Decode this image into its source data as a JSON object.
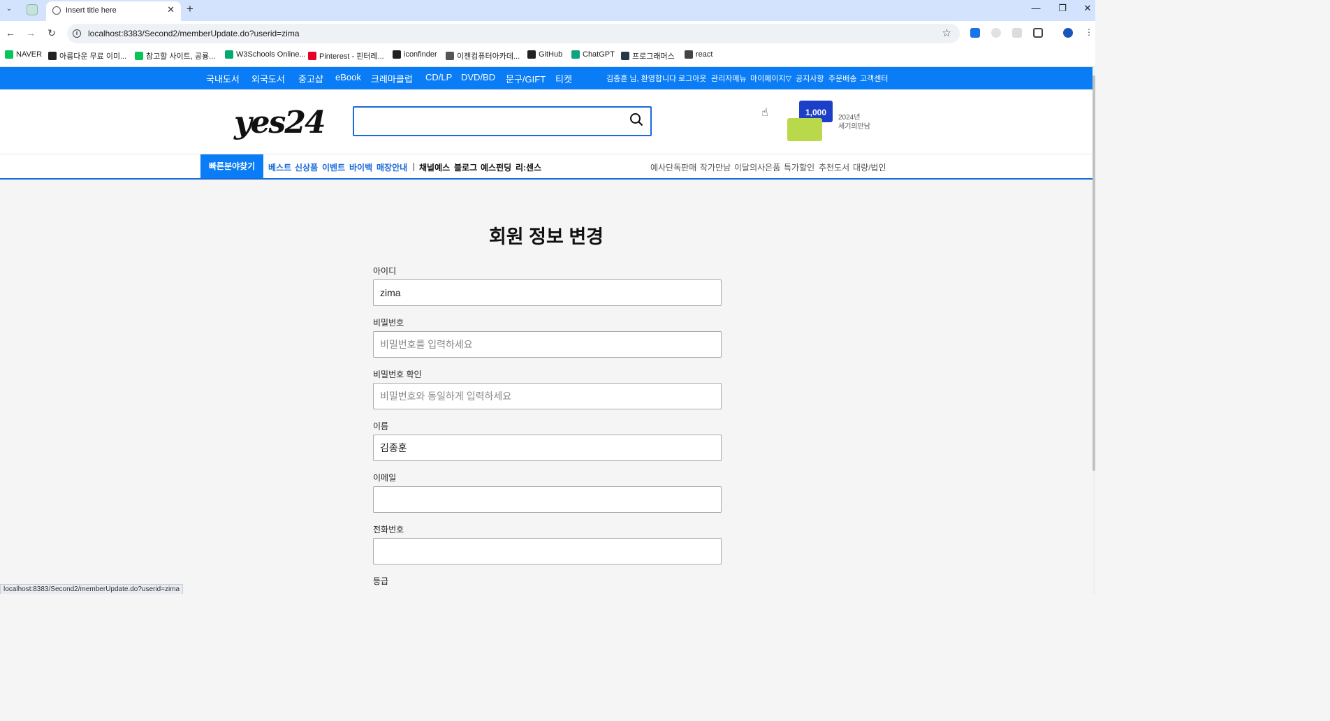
{
  "browser": {
    "tab_title": "Insert title here",
    "url": "localhost:8383/Second2/memberUpdate.do?userid=zima",
    "status_url": "localhost:8383/Second2/memberUpdate.do?userid=zima"
  },
  "bookmarks": [
    {
      "label": "NAVER",
      "icon": "naver-icon",
      "color": "#03c75a"
    },
    {
      "label": "아름다운 무료 이미...",
      "icon": "image-site-icon",
      "color": "#222222"
    },
    {
      "label": "참고할 사이트, 공룡...",
      "icon": "line-icon",
      "color": "#06c755"
    },
    {
      "label": "W3Schools Online...",
      "icon": "w3schools-icon",
      "color": "#04aa6d"
    },
    {
      "label": "Pinterest - 핀터레...",
      "icon": "pinterest-icon",
      "color": "#e60023"
    },
    {
      "label": "iconfinder",
      "icon": "iconfinder-icon",
      "color": "#222222"
    },
    {
      "label": "이젠컴퓨터아카데...",
      "icon": "globe-icon",
      "color": "#555555"
    },
    {
      "label": "GitHub",
      "icon": "github-icon",
      "color": "#222222"
    },
    {
      "label": "ChatGPT",
      "icon": "chatgpt-icon",
      "color": "#10a37f"
    },
    {
      "label": "프로그래머스",
      "icon": "programmers-icon",
      "color": "#263747"
    },
    {
      "label": "react",
      "icon": "folder-icon",
      "color": "#444444"
    }
  ],
  "topnav": {
    "categories": [
      "국내도서",
      "외국도서",
      "중고샵",
      "eBook",
      "크레마클럽",
      "CD/LP",
      "DVD/BD",
      "문구/GIFT",
      "티켓"
    ],
    "user_links": [
      "김종훈 님, 환영합니다",
      "로그아웃",
      "관리자메뉴",
      "마이페이지▽",
      "공지사항",
      "주문배송",
      "고객센터"
    ]
  },
  "header": {
    "logo_text": "yes24",
    "search_placeholder": "",
    "promo_card_value": "1,000",
    "promo_text_1": "2024년",
    "promo_text_2": "세기의만남"
  },
  "subnav": {
    "quick_button": "빠른분야찾기",
    "blue_links": [
      "베스트",
      "신상품",
      "이벤트",
      "바이백",
      "매장안내"
    ],
    "black_links": [
      "채널예스",
      "블로그",
      "예스펀딩",
      "리:센스"
    ],
    "gray_links": [
      "예사단독판매",
      "작가만남",
      "이달의사은품",
      "특가할인",
      "추천도서",
      "대량/법인"
    ]
  },
  "form": {
    "title": "회원 정보 변경",
    "fields": [
      {
        "label": "아이디",
        "value": "zima",
        "placeholder": ""
      },
      {
        "label": "비밀번호",
        "value": "",
        "placeholder": "비밀번호를 입력하세요"
      },
      {
        "label": "비밀번호 확인",
        "value": "",
        "placeholder": "비밀번호와 동일하게 입력하세요"
      },
      {
        "label": "이름",
        "value": "김종훈",
        "placeholder": ""
      },
      {
        "label": "이메일",
        "value": "",
        "placeholder": ""
      },
      {
        "label": "전화번호",
        "value": "",
        "placeholder": ""
      }
    ],
    "grade_label": "등급"
  },
  "colors": {
    "brand_blue": "#0a7cf5",
    "accent_blue": "#1a6ad9",
    "tab_strip": "#d3e3fd"
  }
}
